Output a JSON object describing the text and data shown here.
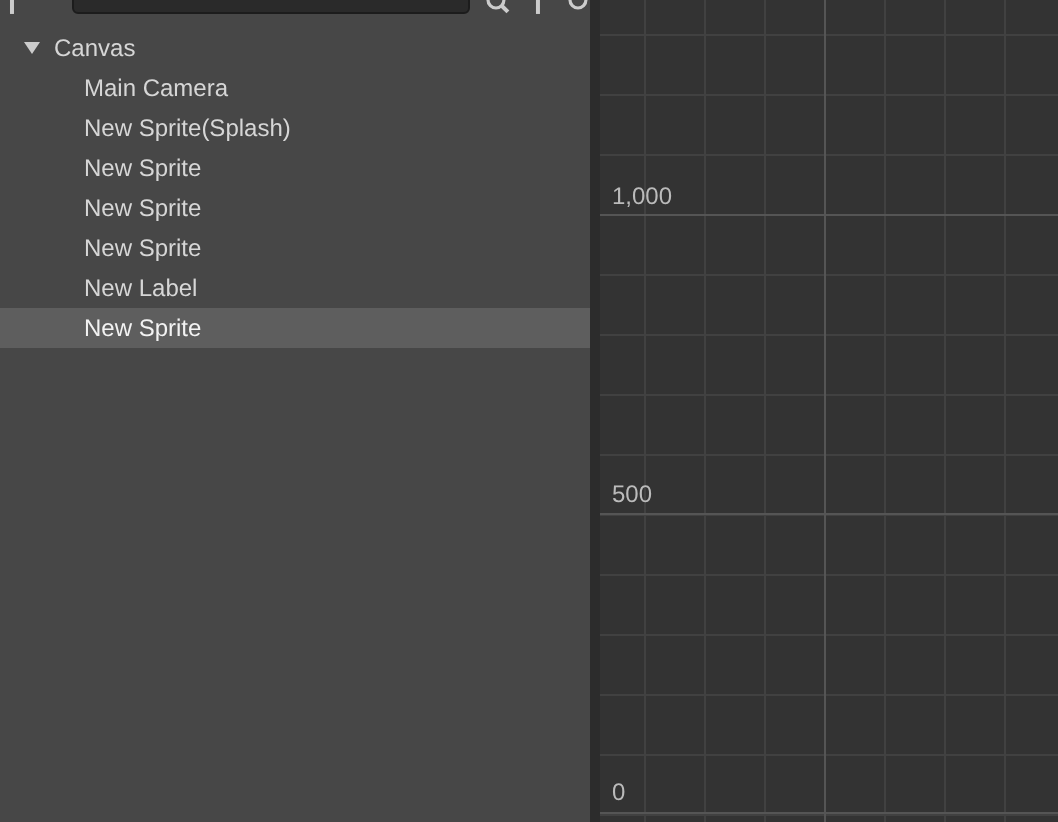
{
  "hierarchy": {
    "tree": [
      {
        "label": "Canvas",
        "expanded": true,
        "selected": false,
        "children": [
          {
            "label": "Main Camera",
            "selected": false
          },
          {
            "label": "New Sprite(Splash)",
            "selected": false
          },
          {
            "label": "New Sprite",
            "selected": false
          },
          {
            "label": "New Sprite",
            "selected": false
          },
          {
            "label": "New Sprite",
            "selected": false
          },
          {
            "label": "New Label",
            "selected": false
          },
          {
            "label": "New Sprite",
            "selected": true
          }
        ]
      }
    ]
  },
  "scene": {
    "axis_labels": [
      "1,000",
      "500",
      "0"
    ]
  }
}
